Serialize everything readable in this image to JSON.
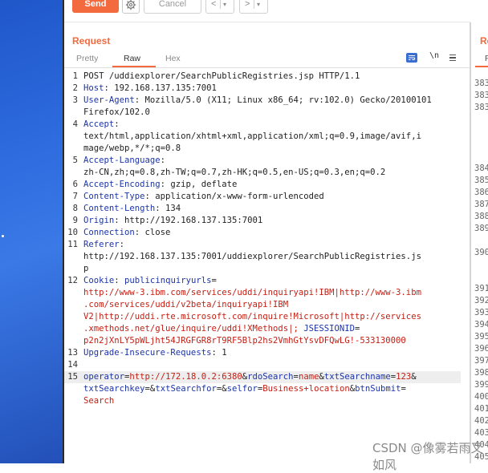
{
  "toolbar": {
    "send_label": "Send",
    "cancel_label": "Cancel",
    "back_glyph": "<",
    "forward_glyph": ">",
    "dropdown_glyph": "▾"
  },
  "request": {
    "title": "Request",
    "tabs": [
      "Pretty",
      "Raw",
      "Hex"
    ],
    "active_tab": "Raw",
    "newline_label": "\\n",
    "menu_glyph": "≡"
  },
  "response": {
    "title": "Re",
    "tab_fragment": "P",
    "line_numbers": [
      "383",
      "383",
      "383",
      "384",
      "385",
      "386",
      "387",
      "388",
      "389",
      "390",
      "391",
      "392",
      "393",
      "394",
      "395",
      "396",
      "397",
      "398",
      "399",
      "400",
      "401",
      "402",
      "403",
      "404",
      "405"
    ]
  },
  "editor": {
    "line_numbers": [
      "1",
      "2",
      "3",
      "4",
      "5",
      "6",
      "7",
      "8",
      "9",
      "10",
      "11",
      "12",
      "13",
      "14",
      "15"
    ]
  },
  "watermark": "CSDN @像雾若雨又如风",
  "colors": {
    "accent": "#f26a3e",
    "header_key": "#1c34a8",
    "highlight_value": "#c51d12"
  }
}
